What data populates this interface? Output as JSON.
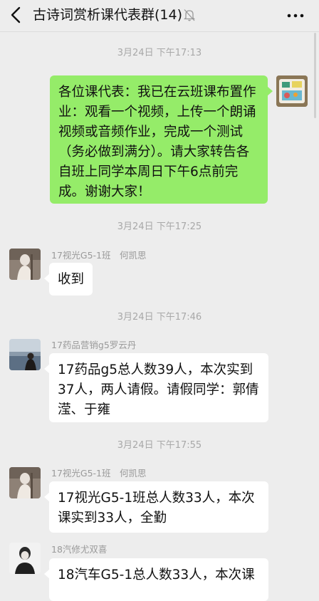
{
  "header": {
    "title": "古诗词赏析课代表群(14)"
  },
  "messages": [
    {
      "timestamp": "3月24日 下午17:13",
      "sender": "",
      "text": "各位课代表：我已在云班课布置作业：观看一个视频，上传一个朗诵视频或音频作业，完成一个测试（务必做到满分）。请大家转告各自班上同学本周日下午6点前完成。谢谢大家！",
      "outgoing": true
    },
    {
      "timestamp": "3月24日 下午17:25",
      "sender": "17视光G5-1班　何凯思",
      "text": "收到",
      "outgoing": false
    },
    {
      "timestamp": "3月24日 下午17:46",
      "sender": "17药品营销g5罗云丹",
      "text": "17药品g5总人数39人，本次实到37人，两人请假。请假同学：郭倩滢、于雍",
      "outgoing": false
    },
    {
      "timestamp": "3月24日 下午17:55",
      "sender": "17视光G5-1班　何凯思",
      "text": "17视光G5-1班总人数33人，本次课实到33人，全勤",
      "outgoing": false
    },
    {
      "timestamp": "",
      "sender": "18汽修尤双喜",
      "text": "18汽车G5-1总人数33人，本次课",
      "outgoing": false
    }
  ],
  "colors": {
    "background": "#ededed",
    "outgoing_bubble": "#95ec69",
    "incoming_bubble": "#ffffff",
    "timestamp_text": "#a8a8a8"
  },
  "icons": [
    "back-arrow-icon",
    "mute-bell-icon",
    "more-dots-icon"
  ]
}
